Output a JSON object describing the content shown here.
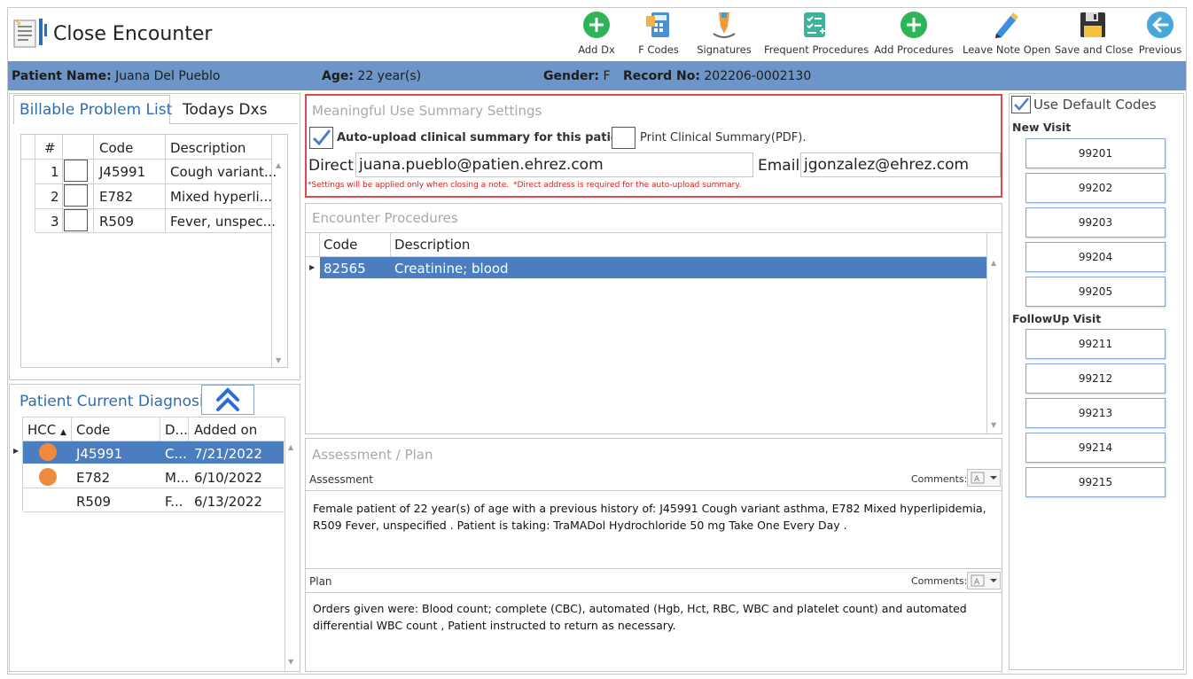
{
  "window": {
    "title": "Close Encounter"
  },
  "toolbar": {
    "add_dx": "Add Dx",
    "f_codes": "F Codes",
    "signatures": "Signatures",
    "frequent_procedures": "Frequent Procedures",
    "add_procedures": "Add Procedures",
    "leave_note_open": "Leave Note Open",
    "save_and_close": "Save and Close",
    "previous": "Previous"
  },
  "patient": {
    "name_label": "Patient Name:",
    "name": "Juana Del Pueblo",
    "age_label": "Age:",
    "age": "22 year(s)",
    "gender_label": "Gender:",
    "gender": "F",
    "record_label": "Record No:",
    "record": "202206-0002130"
  },
  "billable": {
    "tab_active": "Billable Problem List",
    "tab_inactive": "Todays Dxs",
    "headers": {
      "num": "#",
      "code": "Code",
      "description": "Description"
    },
    "rows": [
      {
        "num": "1",
        "code": "J45991",
        "description": "Cough variant..."
      },
      {
        "num": "2",
        "code": "E782",
        "description": "Mixed hyperli..."
      },
      {
        "num": "3",
        "code": "R509",
        "description": "Fever, unspec..."
      }
    ]
  },
  "current_dx": {
    "title": "Patient Current Diagnosis",
    "headers": {
      "hcc": "HCC",
      "code": "Code",
      "d": "D...",
      "added": "Added on"
    },
    "rows": [
      {
        "code": "J45991",
        "d": "C...",
        "added": "7/21/2022"
      },
      {
        "code": "E782",
        "d": "M...",
        "added": "6/10/2022"
      },
      {
        "code": "R509",
        "d": "F...",
        "added": "6/13/2022"
      }
    ]
  },
  "meaningful_use": {
    "title": "Meaningful Use Summary Settings",
    "auto_upload": "Auto-upload clinical summary for this patient.",
    "print_summary": "Print Clinical Summary(PDF).",
    "direct_label": "Direct:",
    "direct_value": "juana.pueblo@patien.ehrez.com",
    "email_label": "Email:",
    "email_value": "jgonzalez@ehrez.com",
    "note1": "*Settings will be applied only when closing a note.",
    "note2": "*Direct address is required for the auto-upload summary."
  },
  "procedures": {
    "title": "Encounter Procedures",
    "headers": {
      "code": "Code",
      "description": "Description"
    },
    "rows": [
      {
        "code": "82565",
        "description": "Creatinine; blood"
      }
    ]
  },
  "assessment_plan": {
    "title": "Assessment / Plan",
    "assessment_label": "Assessment",
    "comments_label": "Comments:",
    "assessment_line1": "Female patient of 22 year(s) of age  with a previous history of: J45991 Cough variant asthma, E782 Mixed hyperlipidemia,",
    "assessment_line2": "R509 Fever, unspecified .  Patient is taking: TraMADol Hydrochloride 50 mg Take One Every Day  .",
    "plan_label": "Plan",
    "plan_line1": "Orders given were: Blood count; complete (CBC), automated (Hgb, Hct, RBC, WBC and platelet count) and automated",
    "plan_line2": "differential WBC count ,      Patient instructed to return as necessary."
  },
  "codes": {
    "use_default": "Use Default Codes",
    "new_visit_label": "New Visit",
    "new_visit": [
      "99201",
      "99202",
      "99203",
      "99204",
      "99205"
    ],
    "followup_label": "FollowUp Visit",
    "followup": [
      "99211",
      "99212",
      "99213",
      "99214",
      "99215"
    ]
  },
  "colors": {
    "accent_blue": "#2d6db0",
    "patient_bar": "#6d95c7",
    "selected_row": "#4b7ec1",
    "hcc_dot": "#ef8a3c",
    "highlight_border": "#e0484d",
    "add_green": "#2fb457"
  }
}
